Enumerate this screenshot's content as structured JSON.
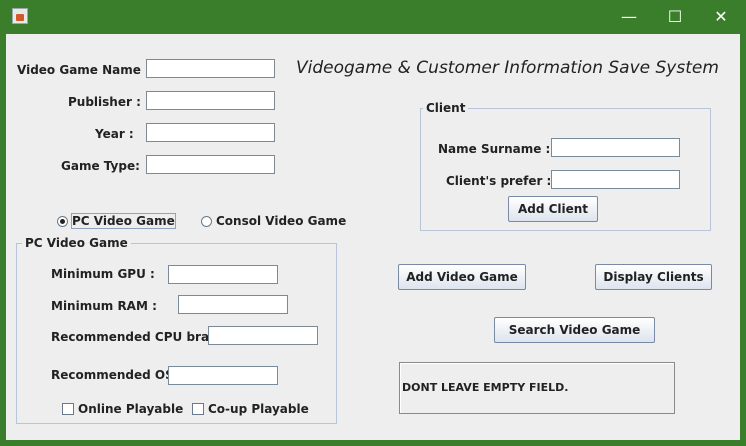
{
  "window": {
    "minimize_glyph": "—",
    "maximize_glyph": "☐",
    "close_glyph": "✕"
  },
  "heading": "Videogame & Customer Information Save System",
  "game_form": {
    "name_label": "Video Game Name :",
    "publisher_label": "Publisher :",
    "year_label": "Year :",
    "type_label": "Game Type:",
    "name_value": "",
    "publisher_value": "",
    "year_value": "",
    "type_value": ""
  },
  "game_kind": {
    "pc_label": "PC Video Game",
    "console_label": "Consol Video Game",
    "selected": "PC Video Game"
  },
  "pc_group": {
    "title": "PC Video Game",
    "gpu_label": "Minimum GPU :",
    "ram_label": "Minimum RAM :",
    "cpu_label": "Recommended CPU brand :",
    "os_label": "Recommended OS :",
    "gpu_value": "",
    "ram_value": "",
    "cpu_value": "",
    "os_value": "",
    "online_label": "Online Playable",
    "coop_label": "Co-up Playable",
    "online_checked": false,
    "coop_checked": false
  },
  "client_group": {
    "title": "Client",
    "name_label": "Name Surname :",
    "prefer_label": "Client's prefer :",
    "name_value": "",
    "prefer_value": "",
    "add_button": "Add Client"
  },
  "actions": {
    "add_game": "Add Video Game",
    "display_clients": "Display Clients",
    "search_game": "Search Video Game"
  },
  "status": {
    "message": "DONT LEAVE EMPTY FIELD."
  }
}
